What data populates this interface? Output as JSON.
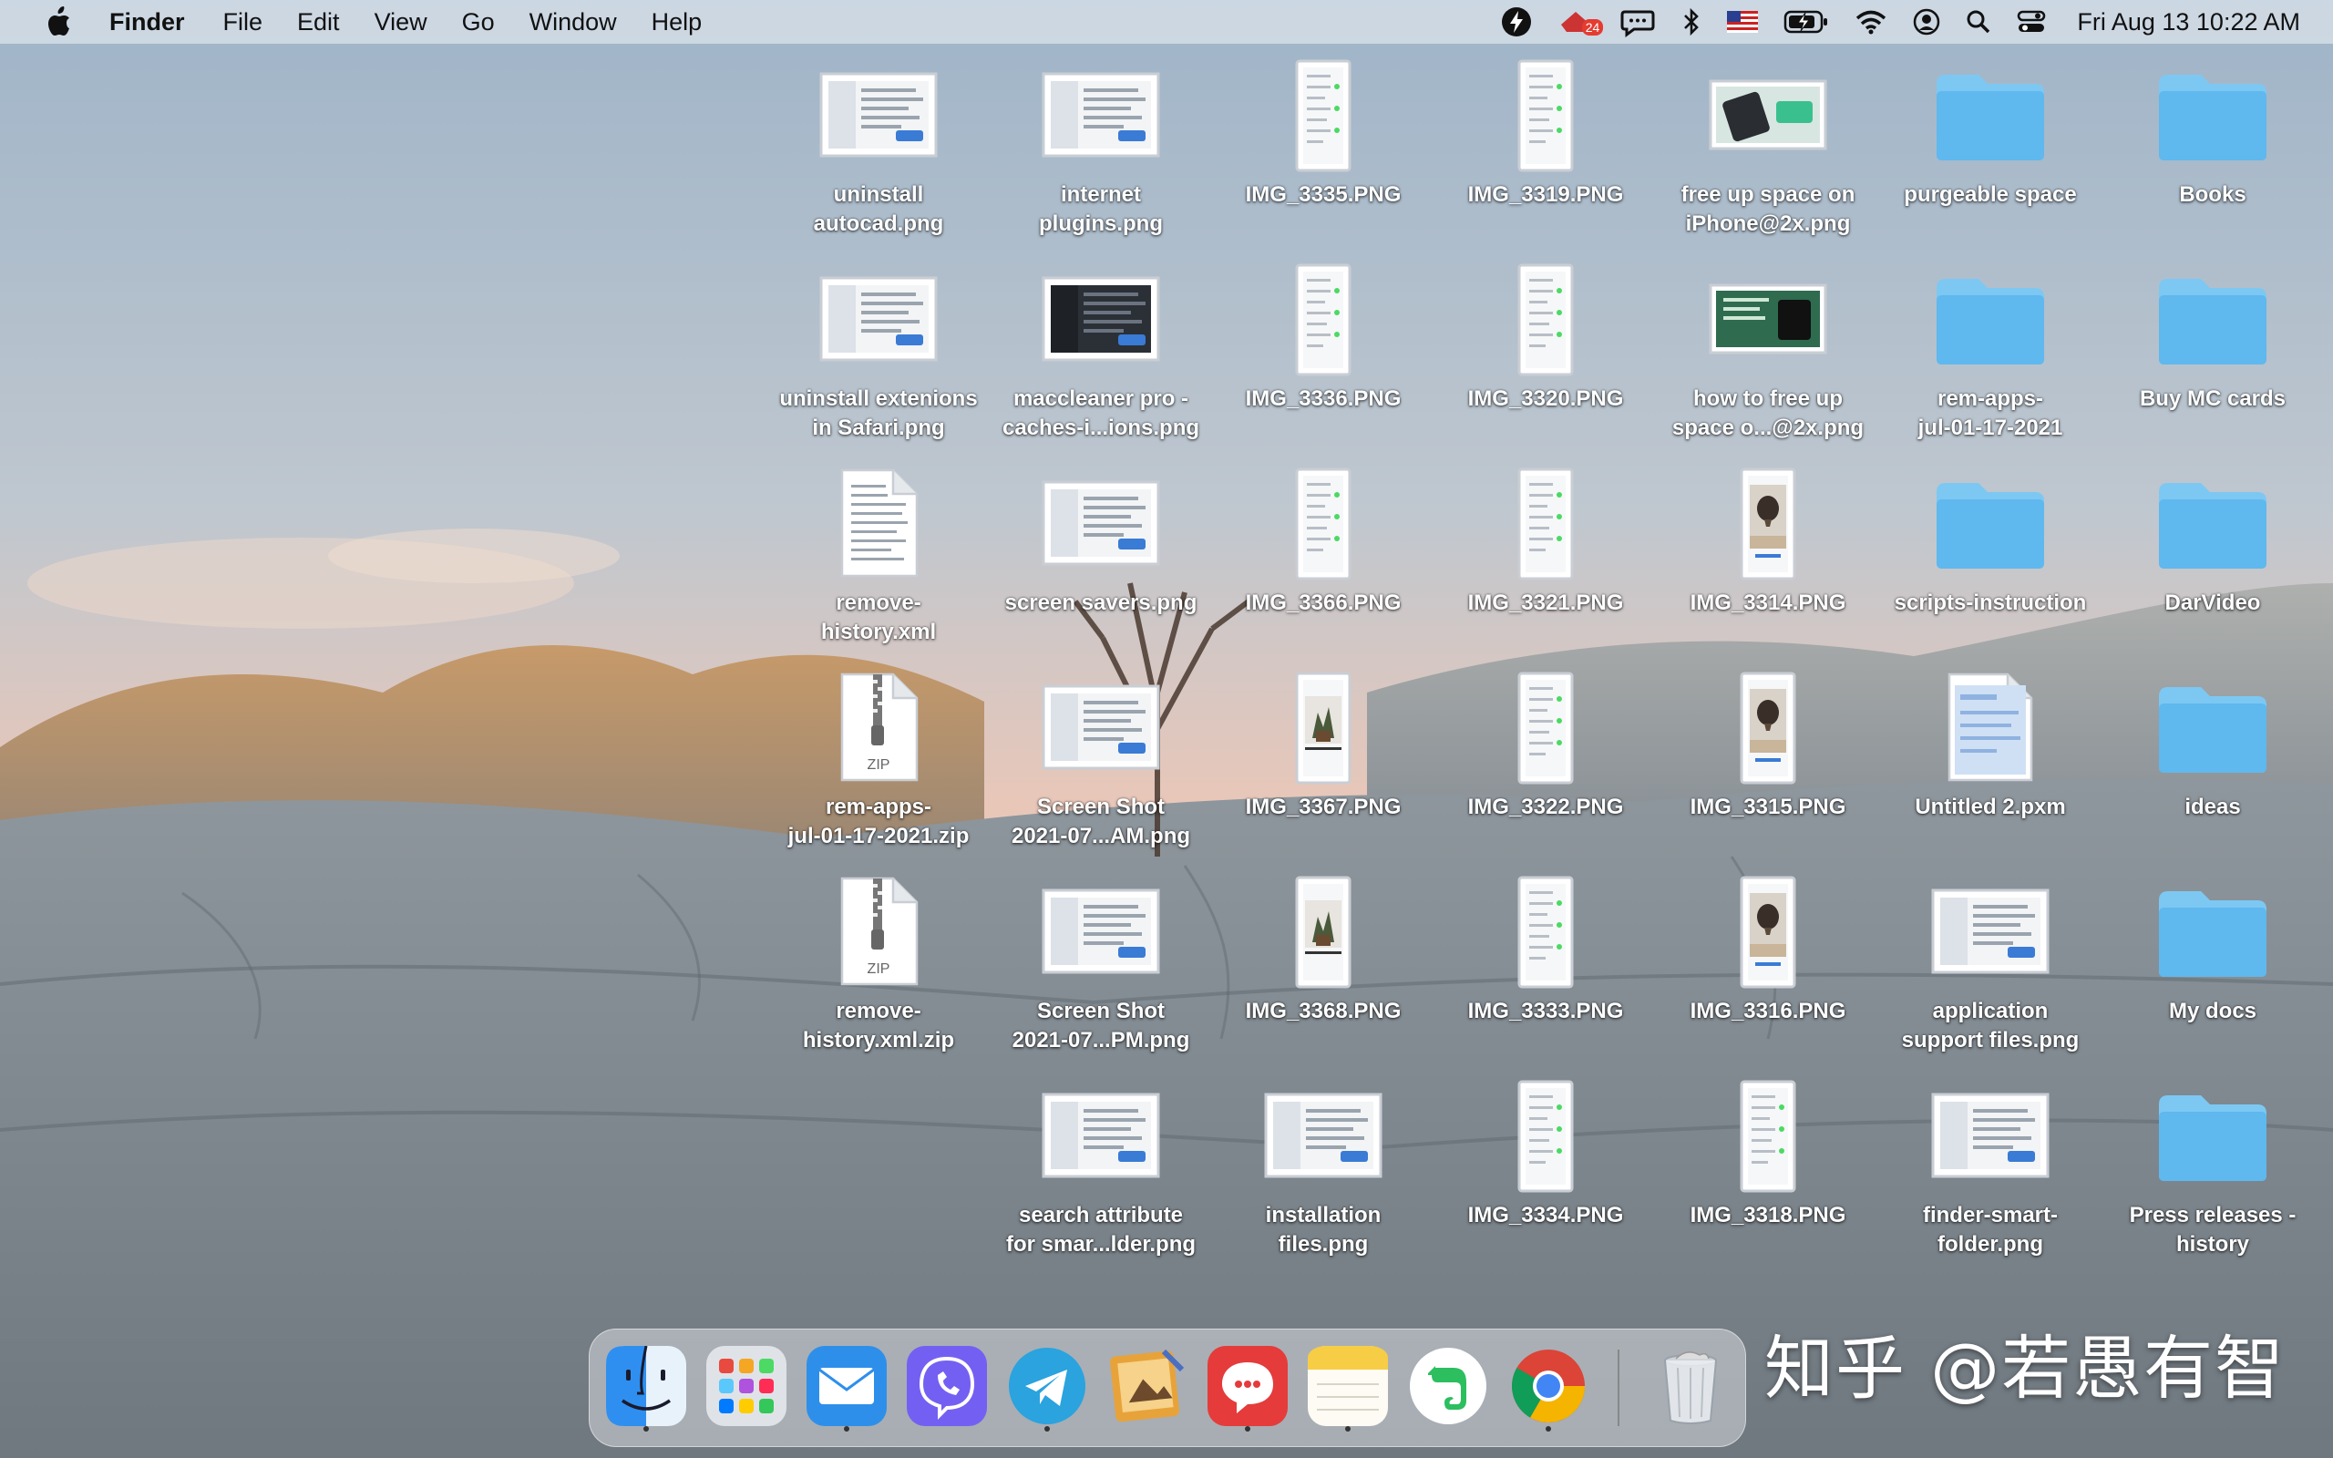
{
  "menubar": {
    "app_name": "Finder",
    "menus": [
      "File",
      "Edit",
      "View",
      "Go",
      "Window",
      "Help"
    ],
    "status_icons": [
      "lightning-icon",
      "app-badge-icon",
      "chat-icon",
      "bluetooth-icon",
      "us-flag-icon",
      "battery-icon",
      "wifi-icon",
      "user-icon",
      "search-icon",
      "control-center-icon"
    ],
    "badge_count": "24",
    "clock": "Fri Aug 13  10:22 AM"
  },
  "desktop": {
    "col1": [
      {
        "name": "uninstall autocad.png",
        "label": "uninstall\nautocad.png",
        "type": "screenshot"
      },
      {
        "name": "uninstall extenions in Safari.png",
        "label": "uninstall extenions\nin Safari.png",
        "type": "screenshot"
      },
      {
        "name": "remove-history.xml",
        "label": "remove-\nhistory.xml",
        "type": "document"
      },
      {
        "name": "rem-apps-jul-01-17-2021.zip",
        "label": "rem-apps-\njul-01-17-2021.zip",
        "type": "zip"
      },
      {
        "name": "remove-history.xml.zip",
        "label": "remove-\nhistory.xml.zip",
        "type": "zip"
      }
    ],
    "col2": [
      {
        "name": "internet plugins.png",
        "label": "internet\nplugins.png",
        "type": "screenshot"
      },
      {
        "name": "maccleaner pro - caches-i...ions.png",
        "label": "maccleaner pro -\ncaches-i...ions.png",
        "type": "screenshot-dark"
      },
      {
        "name": "screen savers.png",
        "label": "screen savers.png",
        "type": "screenshot"
      },
      {
        "name": "Screen Shot 2021-07...AM.png",
        "label": "Screen Shot\n2021-07...AM.png",
        "type": "screenshot"
      },
      {
        "name": "Screen Shot 2021-07...PM.png",
        "label": "Screen Shot\n2021-07...PM.png",
        "type": "screenshot"
      },
      {
        "name": "search attribute for smar...lder.png",
        "label": "search attribute\nfor smar...lder.png",
        "type": "screenshot"
      }
    ],
    "col3": [
      {
        "name": "IMG_3335.PNG",
        "label": "IMG_3335.PNG",
        "type": "phone"
      },
      {
        "name": "IMG_3336.PNG",
        "label": "IMG_3336.PNG",
        "type": "phone"
      },
      {
        "name": "IMG_3366.PNG",
        "label": "IMG_3366.PNG",
        "type": "phone"
      },
      {
        "name": "IMG_3367.PNG",
        "label": "IMG_3367.PNG",
        "type": "phone-photo"
      },
      {
        "name": "IMG_3368.PNG",
        "label": "IMG_3368.PNG",
        "type": "phone-photo"
      },
      {
        "name": "installation files.png",
        "label": "installation\nfiles.png",
        "type": "screenshot"
      }
    ],
    "col4": [
      {
        "name": "IMG_3319.PNG",
        "label": "IMG_3319.PNG",
        "type": "phone"
      },
      {
        "name": "IMG_3320.PNG",
        "label": "IMG_3320.PNG",
        "type": "phone"
      },
      {
        "name": "IMG_3321.PNG",
        "label": "IMG_3321.PNG",
        "type": "phone"
      },
      {
        "name": "IMG_3322.PNG",
        "label": "IMG_3322.PNG",
        "type": "phone"
      },
      {
        "name": "IMG_3333.PNG",
        "label": "IMG_3333.PNG",
        "type": "phone"
      },
      {
        "name": "IMG_3334.PNG",
        "label": "IMG_3334.PNG",
        "type": "phone"
      }
    ],
    "col5": [
      {
        "name": "free up space on iPhone@2x.png",
        "label": "free up space on\niPhone@2x.png",
        "type": "banner"
      },
      {
        "name": "how to free up space o...@2x.png",
        "label": "how to free up\nspace o...@2x.png",
        "type": "banner-green"
      },
      {
        "name": "IMG_3314.PNG",
        "label": "IMG_3314.PNG",
        "type": "phone-balloon"
      },
      {
        "name": "IMG_3315.PNG",
        "label": "IMG_3315.PNG",
        "type": "phone-balloon"
      },
      {
        "name": "IMG_3316.PNG",
        "label": "IMG_3316.PNG",
        "type": "phone-balloon"
      },
      {
        "name": "IMG_3318.PNG",
        "label": "IMG_3318.PNG",
        "type": "phone"
      }
    ],
    "col6": [
      {
        "name": "purgeable space",
        "label": "purgeable space",
        "type": "folder"
      },
      {
        "name": "rem-apps-jul-01-17-2021",
        "label": "rem-apps-\njul-01-17-2021",
        "type": "folder"
      },
      {
        "name": "scripts-instruction",
        "label": "scripts-instruction",
        "type": "folder"
      },
      {
        "name": "Untitled 2.pxm",
        "label": "Untitled 2.pxm",
        "type": "pxm"
      },
      {
        "name": "application support files.png",
        "label": "application\nsupport files.png",
        "type": "screenshot"
      },
      {
        "name": "finder-smart-folder.png",
        "label": "finder-smart-\nfolder.png",
        "type": "screenshot"
      }
    ],
    "col7": [
      {
        "name": "Books",
        "label": "Books",
        "type": "folder"
      },
      {
        "name": "Buy MC cards",
        "label": "Buy MC cards",
        "type": "folder"
      },
      {
        "name": "DarVideo",
        "label": "DarVideo",
        "type": "folder"
      },
      {
        "name": "ideas",
        "label": "ideas",
        "type": "folder"
      },
      {
        "name": "My docs",
        "label": "My docs",
        "type": "folder"
      },
      {
        "name": "Press releases - history",
        "label": "Press releases -\nhistory",
        "type": "folder"
      }
    ]
  },
  "dock": {
    "apps": [
      {
        "name": "finder",
        "running": true
      },
      {
        "name": "launchpad",
        "running": false
      },
      {
        "name": "mail",
        "running": true
      },
      {
        "name": "viber",
        "running": false
      },
      {
        "name": "telegram",
        "running": true
      },
      {
        "name": "preview",
        "running": false
      },
      {
        "name": "speech-bubble-app",
        "running": true
      },
      {
        "name": "notes",
        "running": true
      },
      {
        "name": "evernote",
        "running": false
      },
      {
        "name": "chrome",
        "running": true
      }
    ],
    "trash": "trash"
  },
  "watermark": "知乎 @若愚有智",
  "colors": {
    "folder": "#5fb8ee",
    "folder_tab": "#7cc8f3",
    "menubar_bg": "#dce4ec"
  }
}
